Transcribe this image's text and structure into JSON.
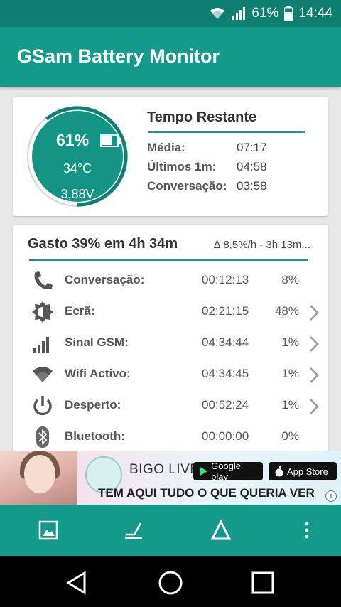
{
  "status_bar": {
    "battery_percent": "61%",
    "time": "14:44",
    "icons": [
      "wifi-icon",
      "signal-icon",
      "battery-icon"
    ]
  },
  "app_bar": {
    "title": "GSam Battery Monitor"
  },
  "battery_card": {
    "gauge": {
      "percent": "61%",
      "level": 0.61,
      "temperature": "34°C",
      "voltage": "3,88V"
    },
    "title": "Tempo Restante",
    "rows": [
      {
        "label": "Média:",
        "value": "07:17"
      },
      {
        "label": "Últimos 1m:",
        "value": "04:58"
      },
      {
        "label": "Conversação:",
        "value": "03:58"
      }
    ]
  },
  "usage_card": {
    "title": "Gasto 39% em 4h 34m",
    "subtitle": "∆ 8,5%/h - 3h 13m...",
    "rows": [
      {
        "label": "Conversação:",
        "time": "00:12:13",
        "percent": "8%",
        "icon": "phone-icon",
        "chevron": false
      },
      {
        "label": "Ecrã:",
        "time": "02:21:15",
        "percent": "48%",
        "icon": "brightness-icon",
        "chevron": true
      },
      {
        "label": "Sinal GSM:",
        "time": "04:34:44",
        "percent": "1%",
        "icon": "signal-bars-icon",
        "chevron": true
      },
      {
        "label": "Wifi Activo:",
        "time": "04:34:45",
        "percent": "1%",
        "icon": "wifi-icon",
        "chevron": true
      },
      {
        "label": "Desperto:",
        "time": "00:52:24",
        "percent": "1%",
        "icon": "power-icon",
        "chevron": true
      },
      {
        "label": "Bluetooth:",
        "time": "00:00:00",
        "percent": "0%",
        "icon": "bluetooth-icon",
        "chevron": false
      }
    ]
  },
  "ad": {
    "brand": "BIGO LIVE",
    "google_play": "Google play",
    "app_store": "App Store",
    "tagline": "TEM AQUI TUDO O QUE QUERIA VER",
    "info": "i"
  },
  "toolbar": {
    "icons": [
      "image-icon",
      "chart-slope-icon",
      "delta-icon",
      "more-vert-icon"
    ]
  },
  "nav_bar": {
    "icons": [
      "back-icon",
      "home-icon",
      "recents-icon"
    ]
  },
  "colors": {
    "primary": "#149a8a",
    "status_bar": "#0e7f70",
    "gauge": "#139484"
  }
}
